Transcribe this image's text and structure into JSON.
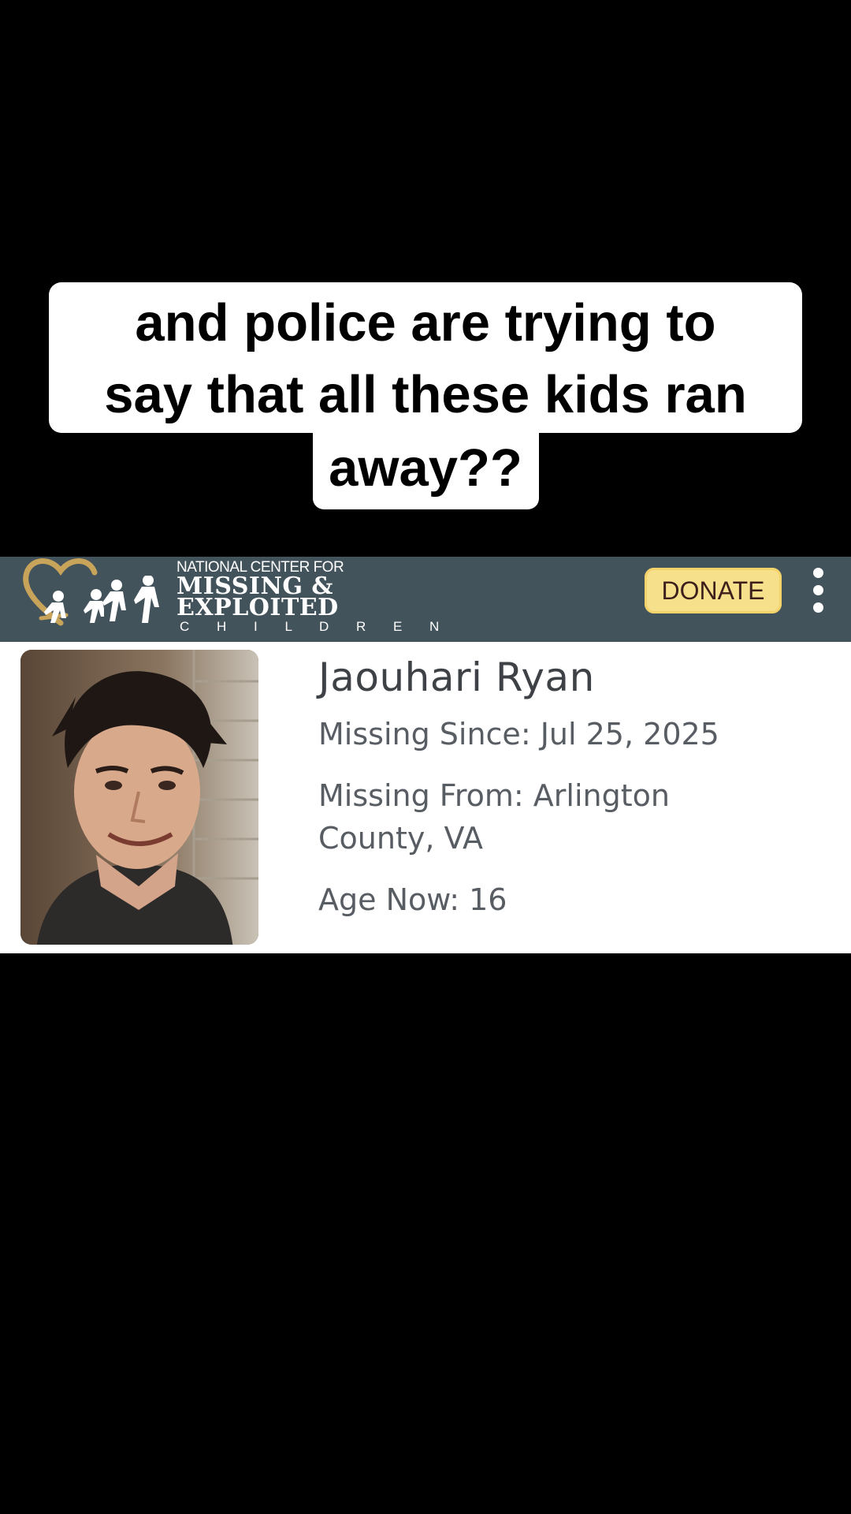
{
  "caption": {
    "line1": "and police are trying to",
    "line2": "say that all these kids ran",
    "line3": "away??"
  },
  "header": {
    "org_top": "NATIONAL CENTER FOR",
    "org_line1": "MISSING &",
    "org_line2": "EXPLOITED",
    "org_line3": "C H I L D R E N",
    "donate_label": "DONATE",
    "menu_icon": "kebab-menu-icon",
    "logo_icon": "heart-children-logo",
    "colors": {
      "header_bg": "#43535c",
      "donate_bg": "#f7e08c",
      "logo_gold": "#c8a45a"
    }
  },
  "poster": {
    "name": "Jaouhari Ryan",
    "missing_since": "Missing Since: Jul 25, 2025",
    "missing_from": "Missing From: Arlington County, VA",
    "age_now": "Age Now: 16",
    "photo": "portrait-photo"
  }
}
